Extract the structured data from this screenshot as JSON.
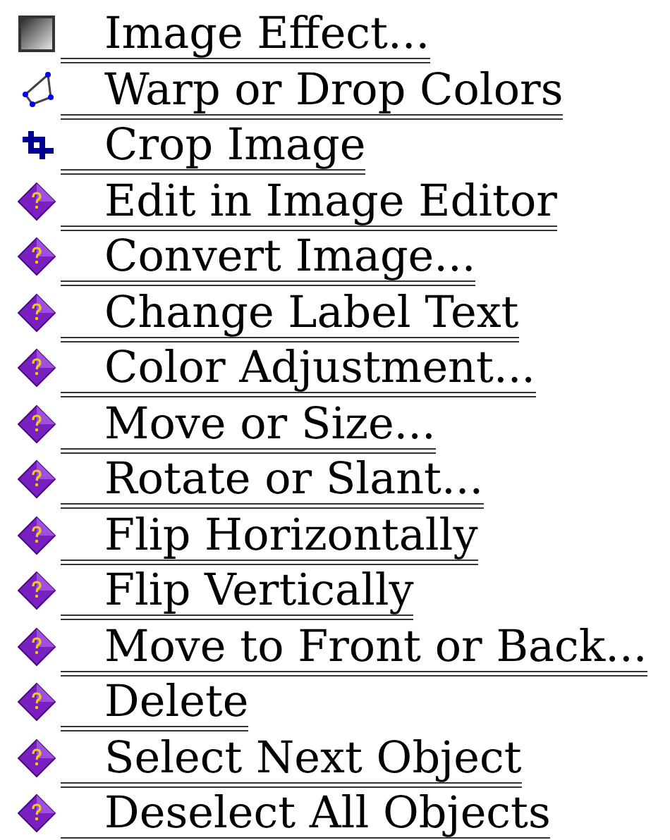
{
  "items": [
    {
      "kind": "effect",
      "label": "Image Effect..."
    },
    {
      "kind": "warp",
      "label": "Warp or Drop Colors"
    },
    {
      "kind": "crop",
      "label": "Crop Image"
    },
    {
      "kind": "help",
      "label": "Edit in Image Editor"
    },
    {
      "kind": "help",
      "label": "Convert Image..."
    },
    {
      "kind": "help",
      "label": "Change Label Text"
    },
    {
      "kind": "help",
      "label": "Color Adjustment..."
    },
    {
      "kind": "help",
      "label": "Move or Size..."
    },
    {
      "kind": "help",
      "label": "Rotate or Slant..."
    },
    {
      "kind": "help",
      "label": "Flip Horizontally"
    },
    {
      "kind": "help",
      "label": "Flip Vertically"
    },
    {
      "kind": "help",
      "label": "Move to Front or Back..."
    },
    {
      "kind": "help",
      "label": "Delete"
    },
    {
      "kind": "help",
      "label": "Select Next Object"
    },
    {
      "kind": "help",
      "label": "Deselect All Objects"
    }
  ]
}
